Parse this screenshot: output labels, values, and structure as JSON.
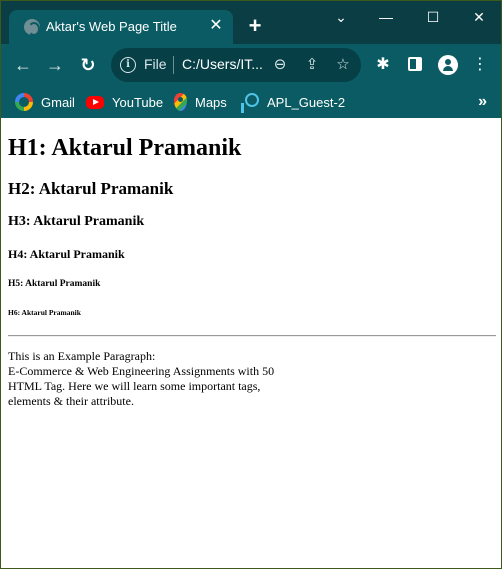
{
  "browser": {
    "tab": {
      "title": "Aktar's Web Page Title",
      "close_glyph": "✕"
    },
    "new_tab_glyph": "+",
    "window_controls": {
      "dropdown": "⌄",
      "minimize": "—",
      "maximize": "☐",
      "close": "✕"
    },
    "toolbar": {
      "back_glyph": "←",
      "forward_glyph": "→",
      "reload_glyph": "↻",
      "omnibox": {
        "scheme_label": "File",
        "url": "C:/Users/IT...",
        "info_glyph": "i"
      },
      "zoom_glyph": "⊖",
      "share_glyph": "⇪",
      "bookmark_glyph": "☆",
      "extensions_glyph": "✱",
      "menu_glyph": "⋮"
    },
    "bookmarks": [
      {
        "label": "Gmail",
        "icon": "google-icon"
      },
      {
        "label": "YouTube",
        "icon": "youtube-icon"
      },
      {
        "label": "Maps",
        "icon": "maps-icon"
      },
      {
        "label": "APL_Guest-2",
        "icon": "apl-icon"
      }
    ],
    "bookmarks_overflow_glyph": "»",
    "colors": {
      "tabstrip": "#0b3d45",
      "toolbar": "#0a5b63",
      "omnibox": "#073f47"
    }
  },
  "page": {
    "h1": "H1: Aktarul Pramanik",
    "h2": "H2: Aktarul Pramanik",
    "h3": "H3: Aktarul Pramanik",
    "h4": "H4: Aktarul Pramanik",
    "h5": "H5: Aktarul Pramanik",
    "h6": "H6: Aktarul Pramanik",
    "paragraph_line1": "This is an Example Paragraph:",
    "paragraph_line2": "E-Commerce & Web Engineering Assignments with 50 HTML Tag. Here we will learn some important tags, elements & their attribute."
  }
}
